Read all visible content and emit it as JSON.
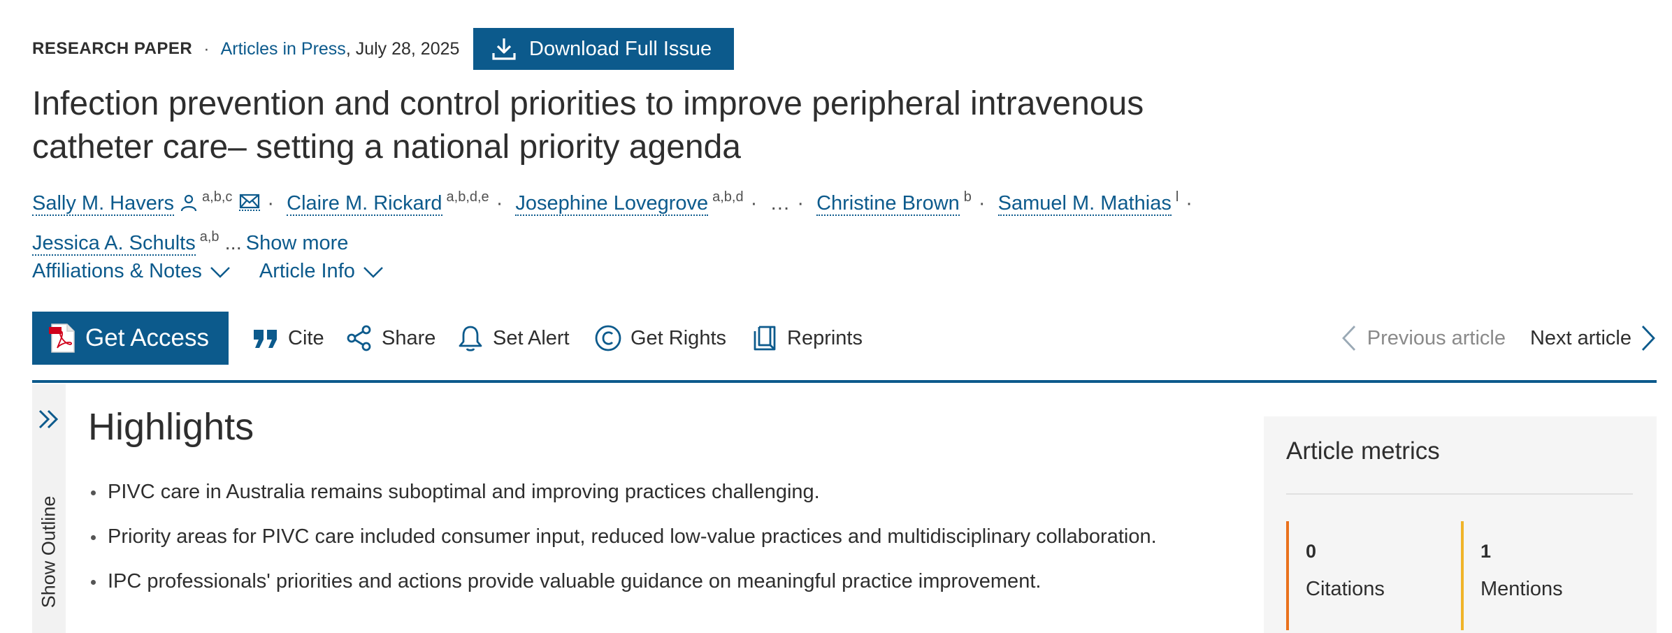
{
  "header": {
    "article_type": "RESEARCH PAPER",
    "separator": "·",
    "section_link": "Articles in Press",
    "date": ", July 28, 2025",
    "download_label": "Download Full Issue"
  },
  "article": {
    "title": "Infection prevention and control priorities to improve peripheral intravenous catheter care– setting a national priority agenda"
  },
  "authors": [
    {
      "name": "Sally M. Havers",
      "sup": "a,b,c"
    },
    {
      "name": "Claire M. Rickard",
      "sup": "a,b,d,e"
    },
    {
      "name": "Josephine Lovegrove",
      "sup": "a,b,d"
    },
    {
      "name": "Christine Brown",
      "sup": "b"
    },
    {
      "name": "Samuel M. Mathias",
      "sup": "l"
    },
    {
      "name": "Jessica A. Schults",
      "sup": "a,b"
    }
  ],
  "authors_ellipsis": "…",
  "authors_trailing": "...",
  "show_more_label": "Show more",
  "dropdowns": {
    "affiliations": "Affiliations & Notes",
    "article_info": "Article Info"
  },
  "toolbar": {
    "get_access": "Get Access",
    "cite": "Cite",
    "share": "Share",
    "set_alert": "Set Alert",
    "get_rights": "Get Rights",
    "reprints": "Reprints",
    "previous_article": "Previous article",
    "next_article": "Next article"
  },
  "outline": {
    "label": "Show Outline"
  },
  "highlights": {
    "title": "Highlights",
    "items": [
      "PIVC care in Australia remains suboptimal and improving practices challenging.",
      "Priority areas for PIVC care included consumer input, reduced low-value practices and multidisciplinary collaboration.",
      "IPC professionals' priorities and actions provide valuable guidance on meaningful practice improvement."
    ]
  },
  "metrics": {
    "title": "Article metrics",
    "citations_count": "0",
    "citations_label": "Citations",
    "mentions_count": "1",
    "mentions_label": "Mentions"
  },
  "colors": {
    "brand_blue": "#0c5a8c",
    "citations_accent": "#e9711c",
    "mentions_accent": "#f0b429"
  }
}
